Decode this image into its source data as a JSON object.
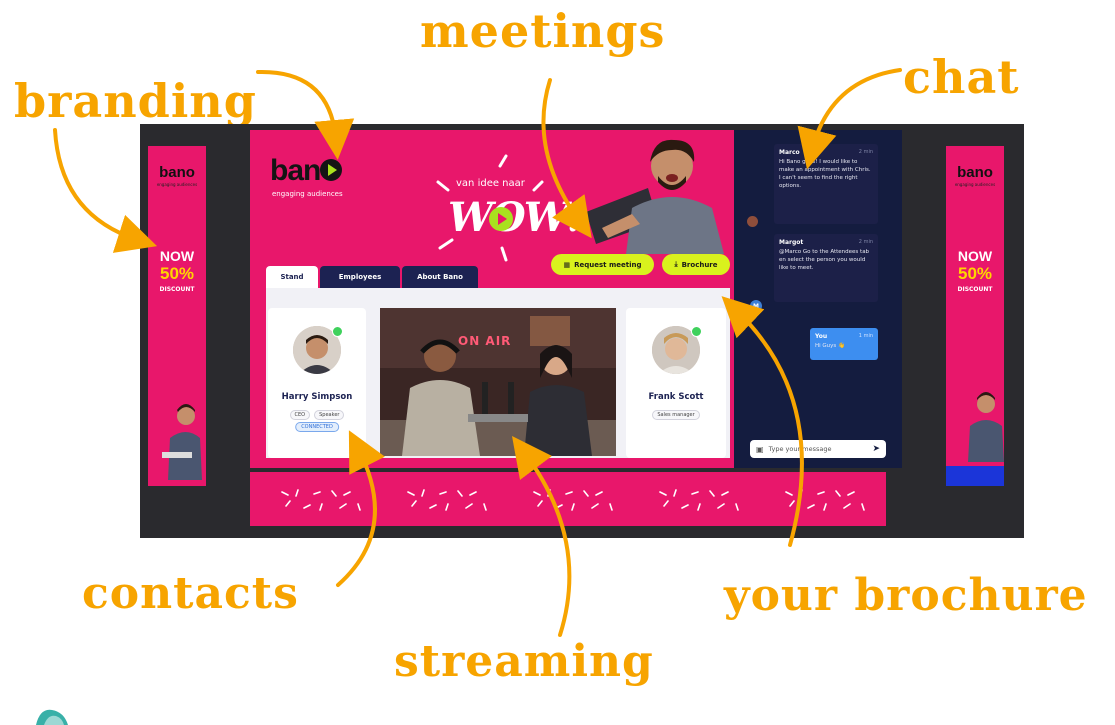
{
  "annotations": {
    "branding": "branding",
    "meetings": "meetings",
    "chat": "chat",
    "contacts": "contacts",
    "streaming": "streaming",
    "brochure": "your brochure"
  },
  "colors": {
    "accent": "#f7a400",
    "brand_pink": "#e8176b",
    "navy": "#141c3f",
    "lime": "#d9f21d"
  },
  "side_banner": {
    "logo": "bano",
    "sub": "engaging audiences",
    "now": "NOW",
    "percent": "50%",
    "discount": "DISCOUNT"
  },
  "booth": {
    "logo": "ban",
    "sub": "engaging audiences",
    "tagline": "van idee naar",
    "wow": "WOW!",
    "request_meeting": "Request meeting",
    "brochure": "Brochure",
    "tabs": [
      {
        "label": "Stand"
      },
      {
        "label": "Employees"
      },
      {
        "label": "About Bano"
      }
    ],
    "stream_sign": "ON AIR"
  },
  "contacts": [
    {
      "name": "Harry Simpson",
      "tags": [
        "CEO",
        "Speaker"
      ],
      "badge": "CONNECTED"
    },
    {
      "name": "Frank Scott",
      "tags": [
        "Sales manager"
      ]
    }
  ],
  "chat": {
    "messages": [
      {
        "name": "Marco",
        "time": "2 min",
        "text": "Hi Bano guys! I would like to make an appointment with Chris. I can't seem to find the right options."
      },
      {
        "name": "Margot",
        "time": "2 min",
        "text": "@Marco Go to the Attendees tab en select the person you would like to meet."
      }
    ],
    "you": {
      "name": "You",
      "time": "1 min",
      "text": "Hi Guys 👋"
    },
    "avatar_initial": "M",
    "input_placeholder": "Type your message"
  }
}
